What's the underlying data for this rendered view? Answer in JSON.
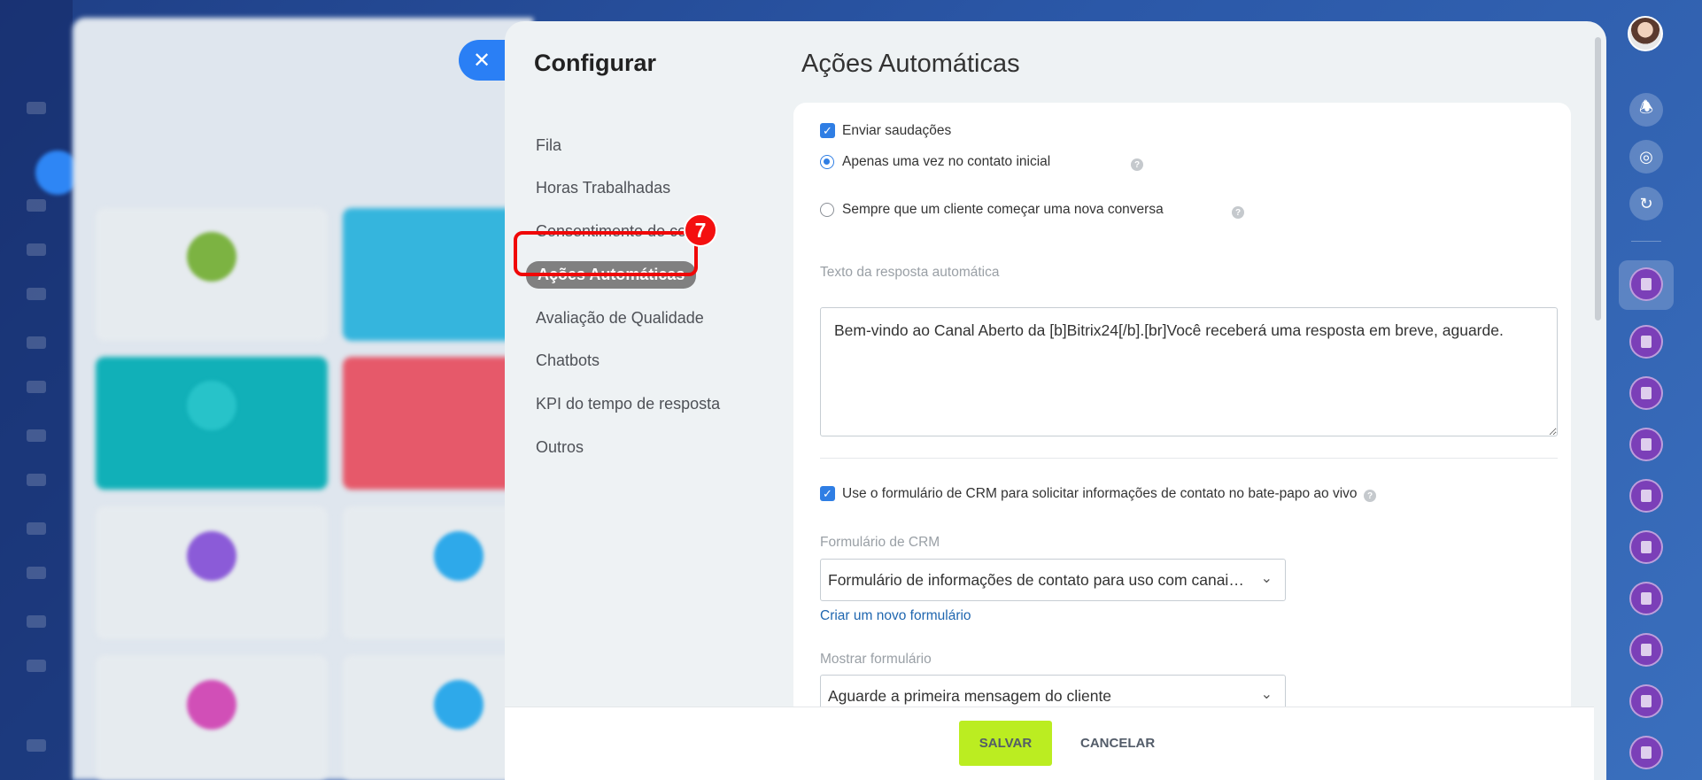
{
  "sidebar_title": "Configurar",
  "menu": {
    "items": [
      {
        "label": "Fila"
      },
      {
        "label": "Horas Trabalhadas"
      },
      {
        "label": "Consentimento de cookie"
      },
      {
        "label": "Ações Automáticas"
      },
      {
        "label": "Avaliação de Qualidade"
      },
      {
        "label": "Chatbots"
      },
      {
        "label": "KPI do tempo de resposta"
      },
      {
        "label": "Outros"
      }
    ],
    "active_index": 3,
    "step_badge": "7"
  },
  "page_title": "Ações Automáticas",
  "form": {
    "send_greetings": {
      "label": "Enviar saudações",
      "checked": true
    },
    "greeting_mode": {
      "options": [
        {
          "label": "Apenas uma vez no contato inicial",
          "selected": true
        },
        {
          "label": "Sempre que um cliente começar uma nova conversa",
          "selected": false
        }
      ]
    },
    "auto_reply": {
      "label": "Texto da resposta automática",
      "value": "Bem-vindo ao Canal Aberto da [b]Bitrix24[/b].[br]Você receberá uma resposta em breve, aguarde."
    },
    "use_crm_form": {
      "label": "Use o formulário de CRM para solicitar informações de contato no bate-papo ao vivo",
      "checked": true
    },
    "crm_form": {
      "label": "Formulário de CRM",
      "value": "Formulário de informações de contato para uso com canais abertos"
    },
    "create_form_link": "Criar um novo formulário",
    "show_form": {
      "label": "Mostrar formulário",
      "value": "Aguarde a primeira mensagem do cliente"
    }
  },
  "footer": {
    "save_label": "SALVAR",
    "cancel_label": "CANCELAR"
  },
  "icons": {
    "close": "close-icon",
    "help": "help-icon",
    "chevron": "chevron-down-icon",
    "notifications": "bell-icon"
  },
  "colors": {
    "accent": "#2f7ee4",
    "save_button": "#bbed21",
    "highlight": "#f41010"
  }
}
